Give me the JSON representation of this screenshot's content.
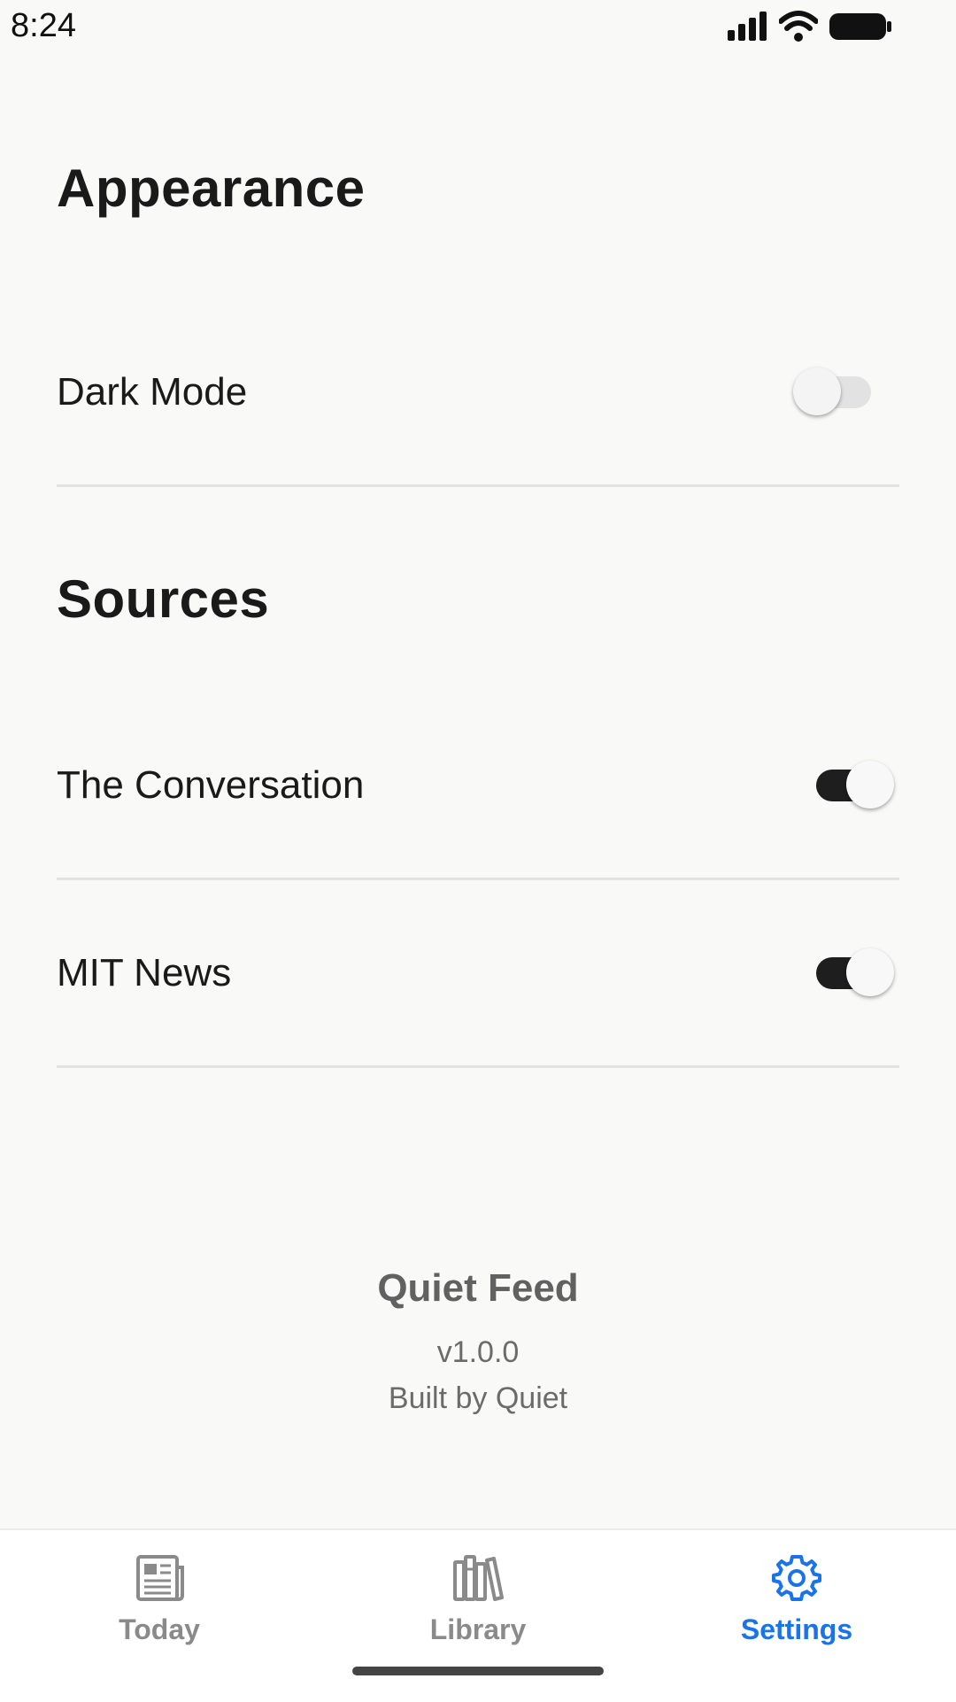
{
  "status_bar": {
    "time": "8:24"
  },
  "appearance": {
    "title": "Appearance",
    "dark_mode": {
      "label": "Dark Mode",
      "enabled": false
    }
  },
  "sources": {
    "title": "Sources",
    "items": [
      {
        "label": "The Conversation",
        "enabled": true
      },
      {
        "label": "MIT News",
        "enabled": true
      }
    ]
  },
  "app_info": {
    "name": "Quiet Feed",
    "version": "v1.0.0",
    "credit": "Built by Quiet"
  },
  "bottom_nav": {
    "items": [
      {
        "label": "Today",
        "icon": "newspaper-icon",
        "active": false
      },
      {
        "label": "Library",
        "icon": "library-icon",
        "active": false
      },
      {
        "label": "Settings",
        "icon": "gear-icon",
        "active": true
      }
    ]
  },
  "colors": {
    "accent": "#1a73e8",
    "background": "#f9f9f7",
    "toggle_on": "#1e1e1e"
  }
}
